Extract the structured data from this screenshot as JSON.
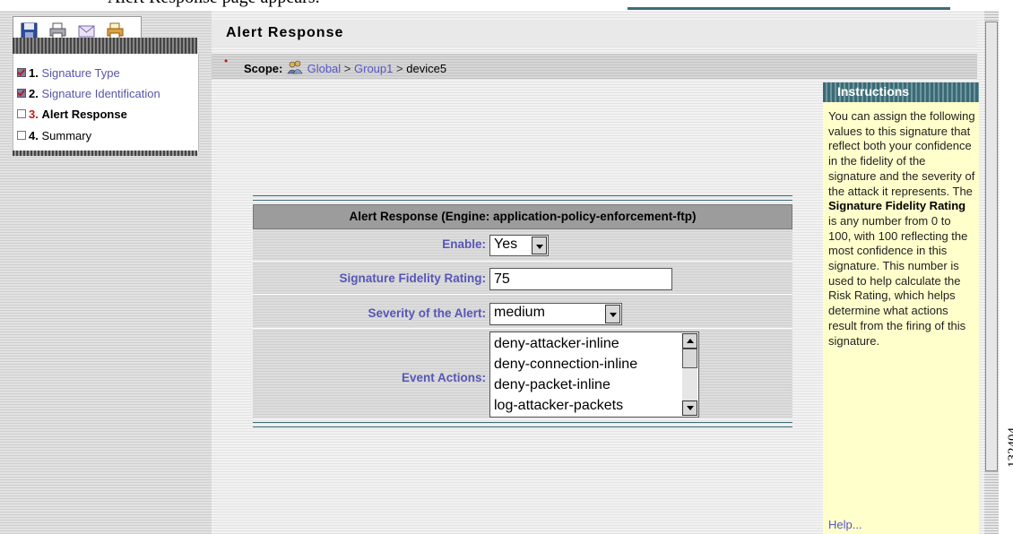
{
  "caption": "Alert Response page appears.",
  "figure_id": "132404",
  "toolbar": {
    "icons": [
      "save-icon",
      "print-icon",
      "email-icon",
      "print-setup-icon"
    ]
  },
  "wizard": {
    "steps": [
      {
        "num": "1.",
        "label": "Signature Type",
        "state": "completed"
      },
      {
        "num": "2.",
        "label": "Signature Identification",
        "state": "completed"
      },
      {
        "num": "3.",
        "label": "Alert Response",
        "state": "current"
      },
      {
        "num": "4.",
        "label": "Summary",
        "state": "pending"
      }
    ]
  },
  "page": {
    "title": "Alert Response"
  },
  "scope": {
    "label": "Scope:",
    "icon": "group-icon",
    "global": "Global",
    "group": "Group1",
    "device": "device5",
    "separator": ">"
  },
  "form": {
    "header": "Alert Response (Engine: application-policy-enforcement-ftp)",
    "enable": {
      "label": "Enable:",
      "value": "Yes"
    },
    "fidelity": {
      "label": "Signature Fidelity Rating:",
      "value": "75"
    },
    "severity": {
      "label": "Severity of the Alert:",
      "value": "medium"
    },
    "event_actions": {
      "label": "Event Actions:",
      "options": [
        "deny-attacker-inline",
        "deny-connection-inline",
        "deny-packet-inline",
        "log-attacker-packets"
      ]
    }
  },
  "instructions": {
    "title": "Instructions",
    "text_1": "You can assign the following values to this signature that reflect both your confidence in the fidelity of the signature and the severity of the attack it represents. The ",
    "bold": "Signature Fidelity Rating",
    "text_2": " is any number from 0 to 100, with 100 reflecting the most confidence in this signature. This number is used to help calculate the Risk Rating, which helps determine what actions result from the firing of this signature.",
    "help": "Help..."
  },
  "colors": {
    "accent_teal": "#3a6b75",
    "link_blue": "#5656c8",
    "instructions_bg": "#ffffcc",
    "current_step_red": "#c21c1c"
  }
}
